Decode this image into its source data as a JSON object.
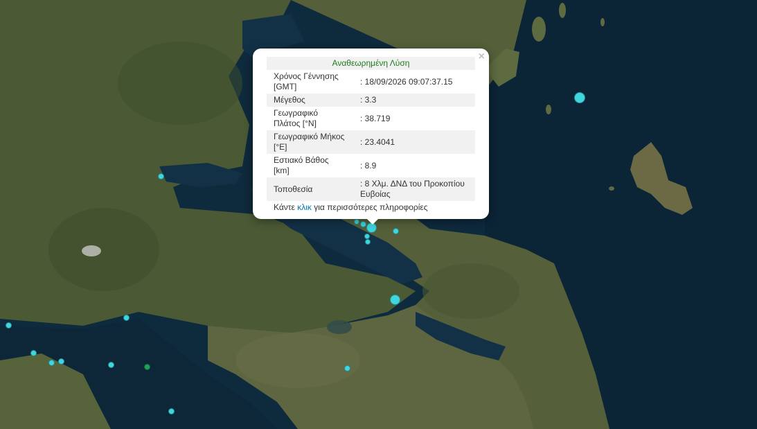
{
  "popup": {
    "title": "Αναθεωρημένη Λύση",
    "close_symbol": "×",
    "rows": [
      {
        "label": "Χρόνος Γέννησης [GMT]",
        "value": ": 18/09/2026 09:07:37.15"
      },
      {
        "label": "Μέγεθος",
        "value": ": 3.3"
      },
      {
        "label": "Γεωγραφικό Πλάτος [°N]",
        "value": ": 38.719"
      },
      {
        "label": "Γεωγραφικό Μήκος [°E]",
        "value": ": 23.4041"
      },
      {
        "label": "Εστιακό Βάθος [km]",
        "value": ": 8.9"
      },
      {
        "label": "Τοποθεσία",
        "value": ": 8 Χλμ. ΔΝΔ του Προκοπίου Ευβοίας"
      }
    ],
    "more_prefix": "Κάντε",
    "more_link": "κλικ",
    "more_suffix": "για περισσότερες πληροφορίες"
  },
  "colors": {
    "quake_cyan": "#3fd6e0",
    "quake_green": "#1fa35a",
    "sea": "#0e2a3d",
    "land": "#4a5a34"
  }
}
